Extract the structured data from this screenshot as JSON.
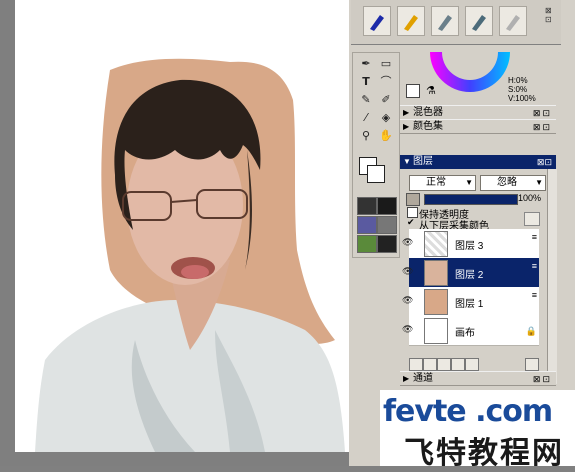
{
  "color_panel": {
    "readouts": [
      "H:0%",
      "S:0%",
      "V:100%"
    ],
    "sections": [
      {
        "label": "混色器"
      },
      {
        "label": "颜色集"
      }
    ]
  },
  "layers_panel": {
    "title": "图层",
    "composite_method": "正常",
    "composite_depth": "忽略",
    "opacity": "100%",
    "checkboxes": [
      {
        "label": "保持透明度",
        "checked": false
      },
      {
        "label": "从下层采集颜色",
        "checked": true
      }
    ],
    "layers": [
      {
        "name": "图层 3",
        "selected": false
      },
      {
        "name": "图层 2",
        "selected": true
      },
      {
        "name": "图层 1",
        "selected": false
      },
      {
        "name": "画布",
        "selected": false
      }
    ],
    "bottom_panel": "通道"
  },
  "watermark": {
    "line1": "fevte .com",
    "line2": "飞特教程网"
  },
  "colors": {
    "ui_gray": "#d4d0c8",
    "selection_blue": "#0a246a",
    "skin_backdrop": "#d8a888",
    "watermark_blue": "#1a4b9a"
  }
}
